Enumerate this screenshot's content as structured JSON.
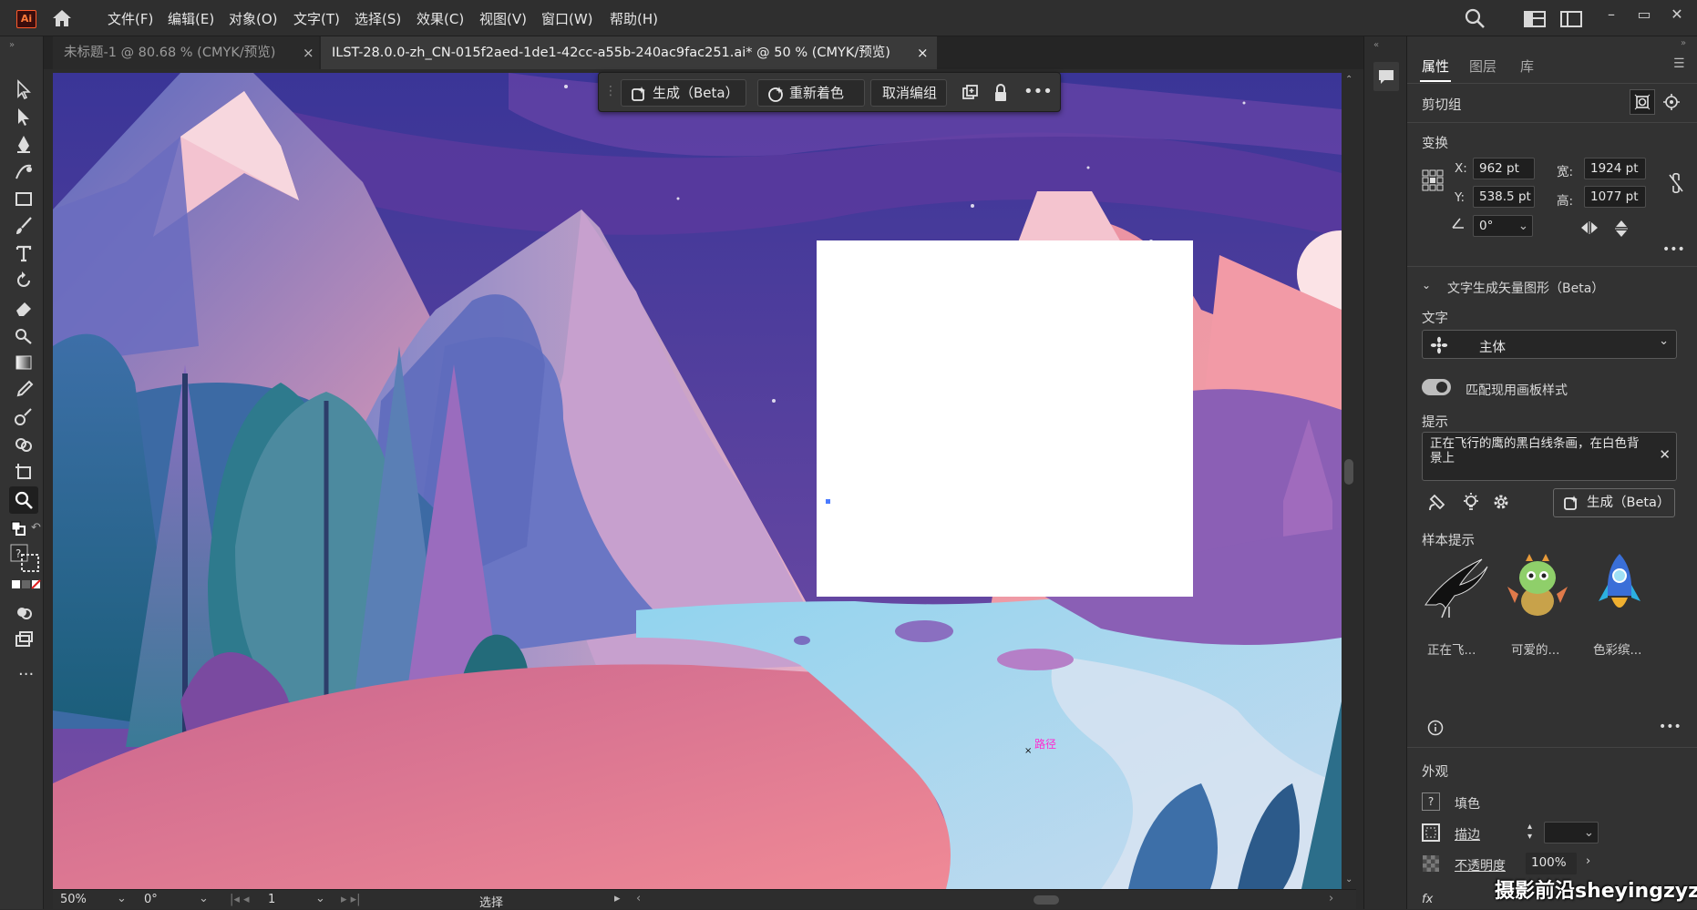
{
  "app": {
    "logo": "Ai"
  },
  "menu": [
    "文件(F)",
    "编辑(E)",
    "对象(O)",
    "文字(T)",
    "选择(S)",
    "效果(C)",
    "视图(V)",
    "窗口(W)",
    "帮助(H)"
  ],
  "tabs": [
    {
      "label": "未标题-1 @ 80.68 % (CMYK/预览)",
      "close": "×",
      "active": false
    },
    {
      "label": "ILST-28.0.0-zh_CN-015f2aed-1de1-42cc-a55b-240ac9fac251.ai* @ 50 % (CMYK/预览)",
      "close": "×",
      "active": true
    }
  ],
  "context_bar": {
    "generate": "生成（Beta）",
    "recolor": "重新着色",
    "ungroup": "取消编组"
  },
  "canvas": {
    "path_label": "路径"
  },
  "status": {
    "zoom": "50%",
    "rotation": "0°",
    "artboard": "1",
    "mode": "选择"
  },
  "panel": {
    "tabs": [
      "属性",
      "图层",
      "库"
    ],
    "section_title": "剪切组",
    "transform": {
      "title": "变换",
      "x_label": "X:",
      "x": "962 pt",
      "y_label": "Y:",
      "y": "538.5 pt",
      "w_label": "宽:",
      "w": "1924 pt",
      "h_label": "高:",
      "h": "1077 pt",
      "angle": "0°"
    },
    "tgv": {
      "title": "文字生成矢量图形（Beta）",
      "type_label": "文字",
      "type_value": "主体",
      "match_style": "匹配现用画板样式",
      "prompt_label": "提示",
      "prompt_text": "正在飞行的鹰的黑白线条画，在白色背景上",
      "generate_button": "生成（Beta）",
      "samples_label": "样本提示",
      "samples": [
        "正在飞...",
        "可爱的...",
        "色彩缤..."
      ]
    },
    "appearance": {
      "title": "外观",
      "fill": "填色",
      "stroke": "描边",
      "opacity_label": "不透明度",
      "opacity": "100%",
      "fx": "fx"
    }
  },
  "watermark": "摄影前沿sheyingzyz.com",
  "colors": {
    "accent": "#2d8cf0",
    "selection": "#4b7bff",
    "path_label": "#ff2bd0"
  }
}
